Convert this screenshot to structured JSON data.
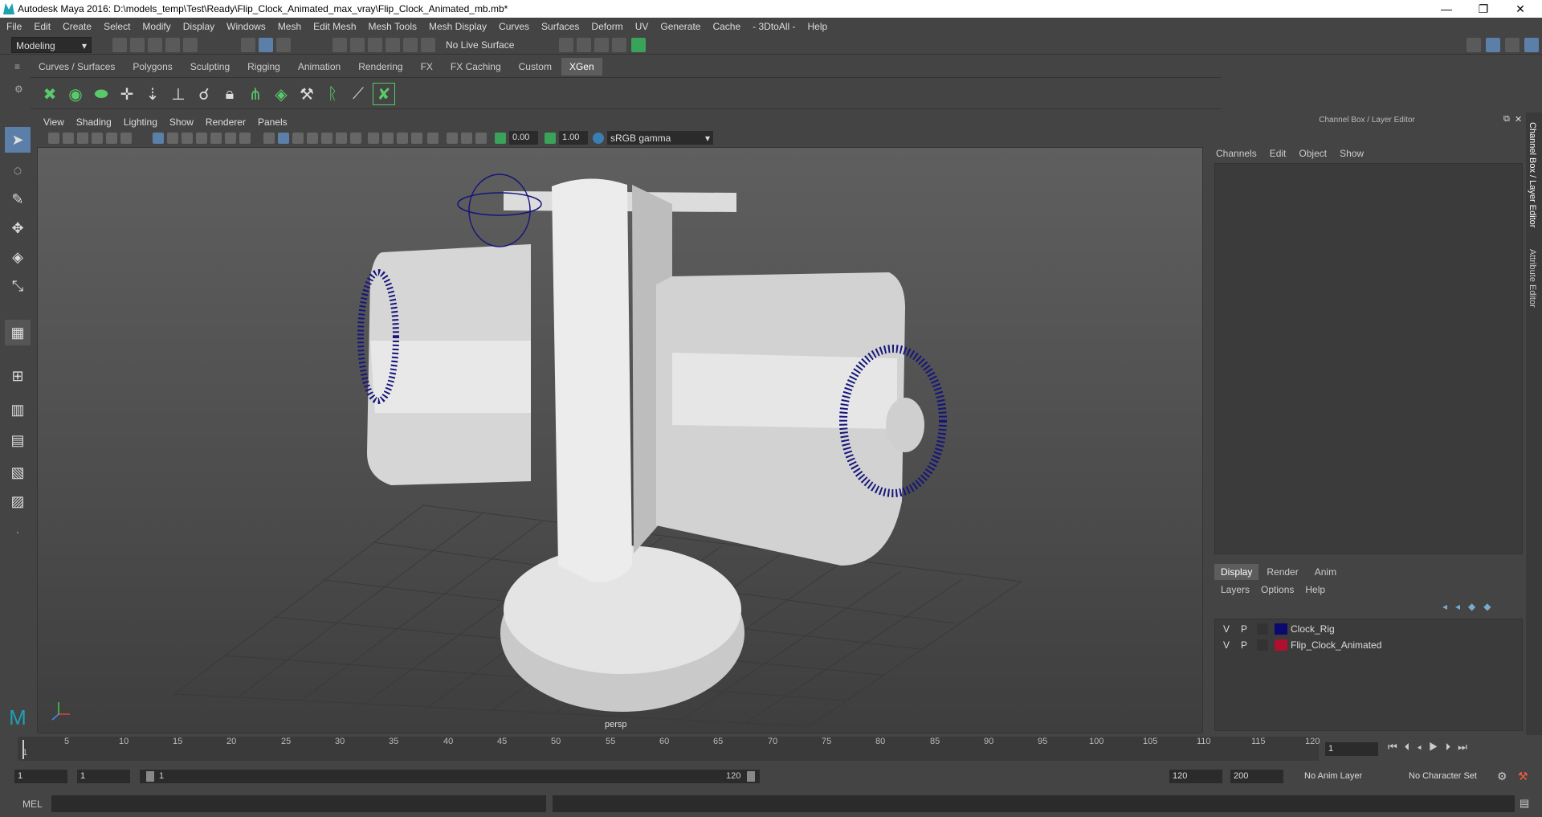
{
  "window": {
    "title": "Autodesk Maya 2016: D:\\models_temp\\Test\\Ready\\Flip_Clock_Animated_max_vray\\Flip_Clock_Animated_mb.mb*",
    "min": "—",
    "max": "❐",
    "close": "✕"
  },
  "menus": [
    "File",
    "Edit",
    "Create",
    "Select",
    "Modify",
    "Display",
    "Windows",
    "Mesh",
    "Edit Mesh",
    "Mesh Tools",
    "Mesh Display",
    "Curves",
    "Surfaces",
    "Deform",
    "UV",
    "Generate",
    "Cache",
    "- 3DtoAll -",
    "Help"
  ],
  "status": {
    "mode": "Modeling",
    "live_surface": "No Live Surface"
  },
  "shelf_tabs": [
    {
      "label": "Curves / Surfaces"
    },
    {
      "label": "Polygons"
    },
    {
      "label": "Sculpting"
    },
    {
      "label": "Rigging"
    },
    {
      "label": "Animation"
    },
    {
      "label": "Rendering"
    },
    {
      "label": "FX"
    },
    {
      "label": "FX Caching"
    },
    {
      "label": "Custom"
    },
    {
      "label": "XGen",
      "active": true
    }
  ],
  "panel_menu": [
    "View",
    "Shading",
    "Lighting",
    "Show",
    "Renderer",
    "Panels"
  ],
  "panel_toolbar": {
    "exposure": "0.00",
    "gamma": "1.00",
    "colorspace": "sRGB gamma"
  },
  "viewport": {
    "camera": "persp"
  },
  "channel_box": {
    "title": "Channel Box / Layer Editor",
    "menus": [
      "Channels",
      "Edit",
      "Object",
      "Show"
    ]
  },
  "layer_tabs": [
    "Display",
    "Render",
    "Anim"
  ],
  "layer_menus": [
    "Layers",
    "Options",
    "Help"
  ],
  "layers": [
    {
      "v": "V",
      "p": "P",
      "color": "#0a0a6e",
      "name": "Clock_Rig"
    },
    {
      "v": "V",
      "p": "P",
      "color": "#b01030",
      "name": "Flip_Clock_Animated"
    }
  ],
  "side_tabs": [
    "Channel Box / Layer Editor",
    "Attribute Editor"
  ],
  "timeline": {
    "ticks": [
      "1",
      "5",
      "10",
      "15",
      "20",
      "25",
      "30",
      "35",
      "40",
      "45",
      "50",
      "55",
      "60",
      "65",
      "70",
      "75",
      "80",
      "85",
      "90",
      "95",
      "100",
      "105",
      "110",
      "115",
      "120"
    ],
    "current": "1"
  },
  "range": {
    "start": "1",
    "anim_start": "1",
    "slider_start": "1",
    "slider_end": "120",
    "end": "120",
    "anim_end": "200",
    "anim_layer": "No Anim Layer",
    "char_set": "No Character Set"
  },
  "cmd": {
    "label": "MEL"
  }
}
